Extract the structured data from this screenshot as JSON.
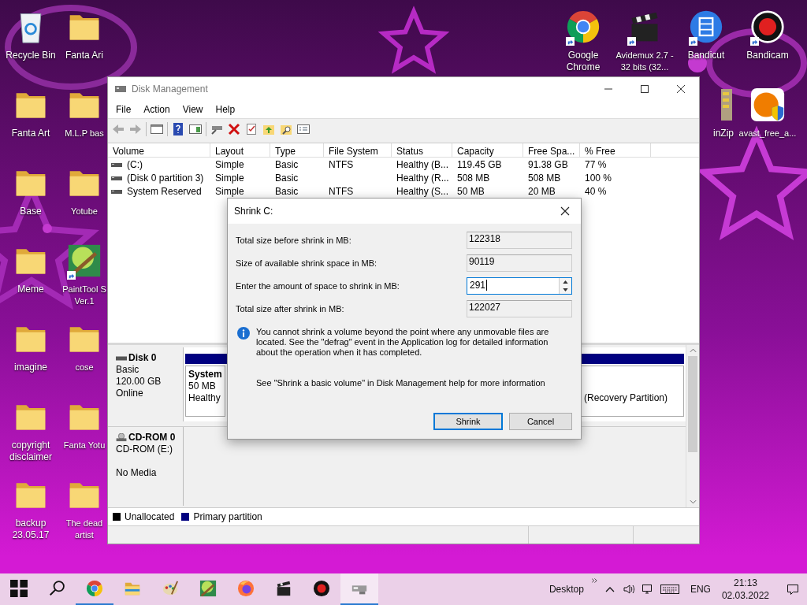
{
  "desktop": {
    "left_icons": [
      {
        "label": "Recycle Bin",
        "kind": "recycle_bin",
        "shortcut": false
      },
      {
        "label": "Fanta Art",
        "kind": "folder",
        "shortcut": false
      },
      {
        "label": "Base",
        "kind": "folder",
        "shortcut": false
      },
      {
        "label": "Meme",
        "kind": "folder",
        "shortcut": false
      },
      {
        "label": "imagine",
        "kind": "folder",
        "shortcut": false
      },
      {
        "label": "copyright disclaimer",
        "kind": "folder",
        "shortcut": false
      },
      {
        "label": "backup 23.05.17",
        "kind": "folder",
        "shortcut": false
      },
      {
        "label": "Fanta Ari",
        "kind": "folder",
        "shortcut": false
      },
      {
        "label": "M.L.P bas",
        "kind": "folder",
        "shortcut": false
      },
      {
        "label": "Yotube",
        "kind": "folder",
        "shortcut": false
      },
      {
        "label": "PaintTool S Ver.1",
        "kind": "paint_app",
        "shortcut": true
      },
      {
        "label": "cose",
        "kind": "folder",
        "shortcut": false
      },
      {
        "label": "Fanta Yotu",
        "kind": "folder",
        "shortcut": false
      },
      {
        "label": "The dead artist",
        "kind": "folder",
        "shortcut": false
      }
    ],
    "right_icons": [
      {
        "label": "Google Chrome",
        "kind": "browser",
        "shortcut": true
      },
      {
        "label": "Avidemux 2.7 - 32 bits (32...",
        "kind": "clapper",
        "shortcut": true
      },
      {
        "label": "Bandicut",
        "kind": "film",
        "shortcut": true
      },
      {
        "label": "Bandicam",
        "kind": "record",
        "shortcut": true
      },
      {
        "label": "inZip",
        "kind": "archive",
        "shortcut": false
      },
      {
        "label": "avast_free_a...",
        "kind": "antivirus",
        "shortcut": false
      }
    ]
  },
  "window": {
    "title": "Disk Management",
    "menu": [
      "File",
      "Action",
      "View",
      "Help"
    ],
    "table": {
      "columns": [
        "Volume",
        "Layout",
        "Type",
        "File System",
        "Status",
        "Capacity",
        "Free Spa...",
        "% Free"
      ],
      "rows": [
        {
          "volume": "(C:)",
          "layout": "Simple",
          "type": "Basic",
          "file_system": "NTFS",
          "status": "Healthy (B...",
          "capacity": "119.45 GB",
          "free_space": "91.38 GB",
          "percent_free": "77 %"
        },
        {
          "volume": "(Disk 0 partition 3)",
          "layout": "Simple",
          "type": "Basic",
          "status": "Healthy (R...",
          "capacity": "508 MB",
          "free_space": "508 MB",
          "percent_free": "100 %"
        },
        {
          "volume": "System Reserved",
          "layout": "Simple",
          "type": "Basic",
          "file_system": "NTFS",
          "status": "Healthy (S...",
          "capacity": "50 MB",
          "free_space": "20 MB",
          "percent_free": "40 %"
        }
      ]
    },
    "disks": [
      {
        "name": "Disk 0",
        "kind": "disk",
        "type": "Basic",
        "size": "120.00 GB",
        "status": "Online",
        "partitions": [
          {
            "title": "System",
            "size": "50 MB",
            "status": "Healthy"
          },
          {
            "status": "(Recovery Partition)"
          }
        ]
      },
      {
        "name": "CD-ROM 0",
        "kind": "cdrom",
        "type": "CD-ROM (E:)",
        "status": "No Media"
      }
    ],
    "legend": [
      {
        "label": "Unallocated",
        "color": "#000000"
      },
      {
        "label": "Primary partition",
        "color": "#000080"
      }
    ]
  },
  "dialog": {
    "title": "Shrink C:",
    "fields": [
      {
        "label": "Total size before shrink in MB:",
        "value": "122318",
        "kind": "readonly"
      },
      {
        "label": "Size of available shrink space in MB:",
        "value": "90119",
        "kind": "readonly"
      },
      {
        "label": "Enter the amount of space to shrink in MB:",
        "value": "291",
        "kind": "spin"
      },
      {
        "label": "Total size after shrink in MB:",
        "value": "122027",
        "kind": "readonly"
      }
    ],
    "info": "You cannot shrink a volume beyond the point where any unmovable files are located. See the \"defrag\" event in the Application log for detailed information about the operation when it has completed.",
    "help": "See \"Shrink a basic volume\" in Disk Management help for more information",
    "buttons": [
      {
        "label": "Shrink",
        "default": true
      },
      {
        "label": "Cancel",
        "default": false
      }
    ]
  },
  "taskbar": {
    "apps": [
      {
        "kind": "browser",
        "running": true,
        "selected": false
      },
      {
        "kind": "explorer",
        "running": false,
        "selected": false
      },
      {
        "kind": "palette",
        "running": false,
        "selected": false
      },
      {
        "kind": "paint_app",
        "running": false,
        "selected": false
      },
      {
        "kind": "firefox",
        "running": false,
        "selected": false
      },
      {
        "kind": "clapper",
        "running": false,
        "selected": false
      },
      {
        "kind": "record",
        "running": false,
        "selected": false
      },
      {
        "kind": "disk_management",
        "running": true,
        "selected": true
      }
    ],
    "toolbar_label": "Desktop",
    "language": "ENG",
    "time": "21:13",
    "date": "02.03.2022"
  }
}
